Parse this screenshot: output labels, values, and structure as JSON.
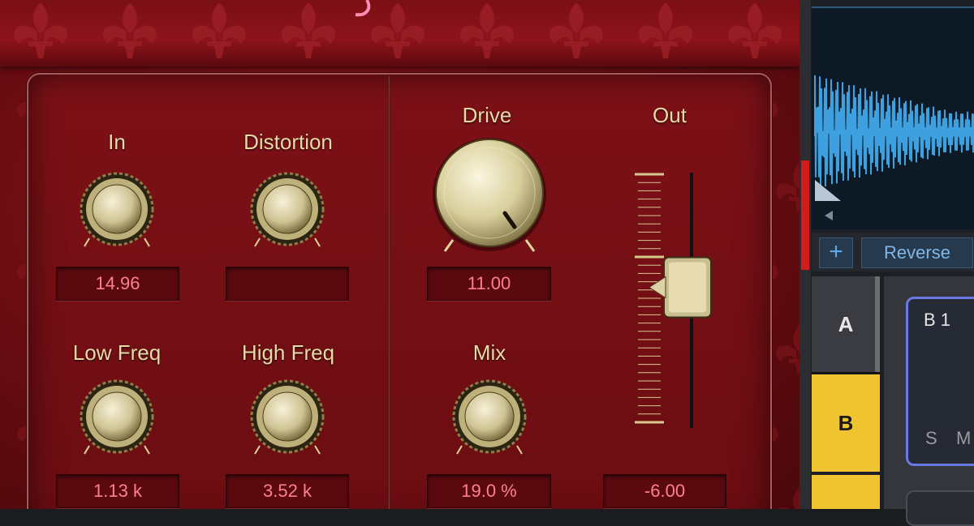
{
  "plugin": {
    "controls": {
      "in": {
        "label": "In",
        "value": "14.96"
      },
      "distortion": {
        "label": "Distortion",
        "value": ""
      },
      "drive": {
        "label": "Drive",
        "value": "11.00"
      },
      "out": {
        "label": "Out",
        "value": "-6.00",
        "fader_level": 0.55
      },
      "low_freq": {
        "label": "Low Freq",
        "value": "1.13 k"
      },
      "high_freq": {
        "label": "High Freq",
        "value": "3.52 k"
      },
      "mix": {
        "label": "Mix",
        "value": "19.0 %"
      }
    }
  },
  "host": {
    "toolbar": {
      "add_label": "+",
      "reverse_label": "Reverse"
    },
    "rows": [
      {
        "label": "A",
        "color": "#3a3c41"
      },
      {
        "label": "B",
        "color": "#f0c430"
      }
    ],
    "pads": [
      {
        "label": "B 1",
        "solo": "S",
        "mute": "M",
        "accent": "#6a78e3"
      }
    ],
    "waveform_color": "#3fa0df"
  },
  "colors": {
    "panel_red": "#7d1117",
    "label_cream": "#e9d9a6",
    "value_pink": "#ff7f8e"
  }
}
